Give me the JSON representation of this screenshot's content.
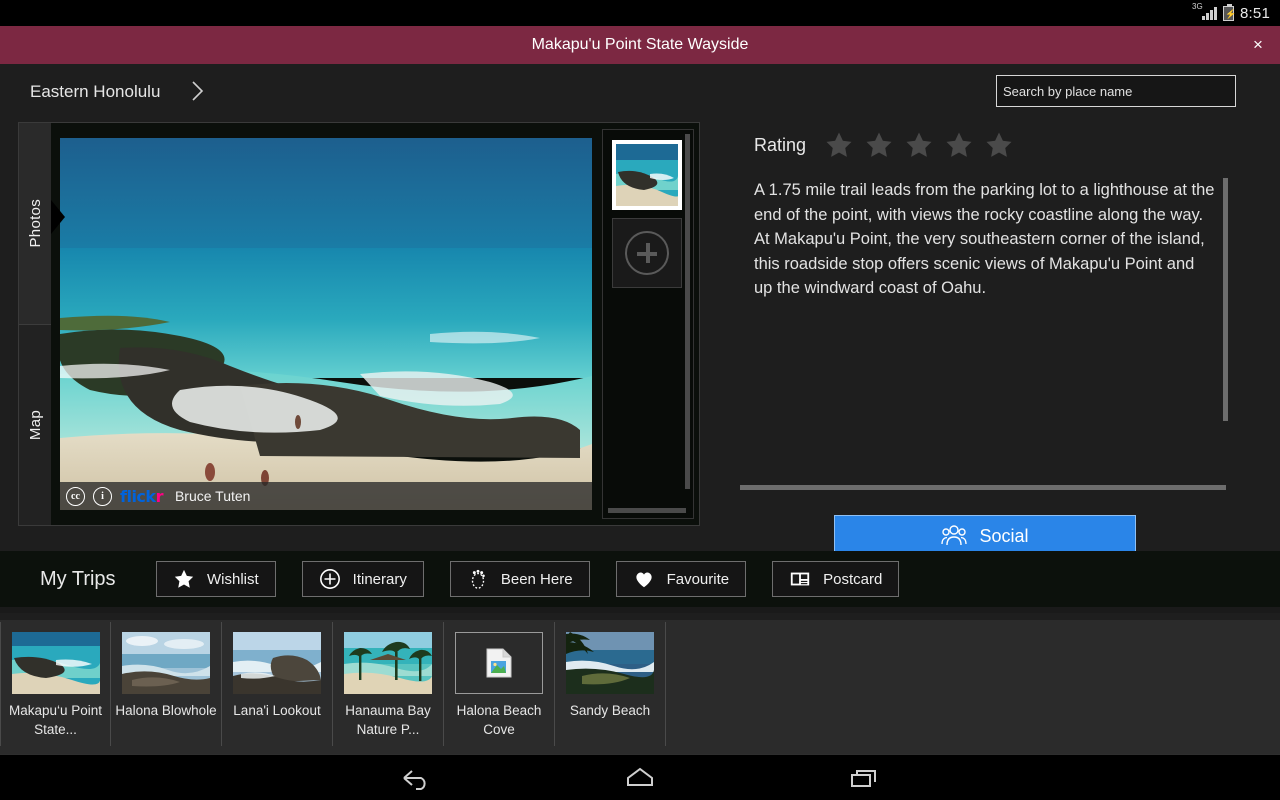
{
  "status_bar": {
    "time": "8:51",
    "network": "3G",
    "signal_icon": "signal-bars-icon",
    "battery_icon": "battery-charging-icon"
  },
  "title_bar": {
    "title": "Makapu'u Point State Wayside",
    "close_label": "×",
    "bg_color": "#7c2842"
  },
  "breadcrumb": {
    "item": "Eastern Honolulu",
    "arrow_icon": "chevron-right-icon"
  },
  "search": {
    "placeholder": "Search by place name",
    "value": ""
  },
  "media": {
    "tabs": [
      {
        "label": "Photos",
        "selected": true
      },
      {
        "label": "Map",
        "selected": false
      }
    ],
    "attribution": {
      "cc_badge": "cc",
      "info_badge": "i",
      "source_part1": "flick",
      "source_part2": "r",
      "author": "Bruce Tuten"
    },
    "thumbnails": [
      {
        "name": "photo-thumbnail-1",
        "selected": true
      },
      {
        "name": "add-photo-button",
        "icon": "plus-icon",
        "selected": false
      }
    ]
  },
  "info": {
    "rating_label": "Rating",
    "stars_total": 5,
    "stars_filled": 0,
    "star_color": "#4a4a4a",
    "description": "A 1.75 mile trail leads from the parking lot to a lighthouse at the end of the point, with views the rocky coastline along the way. At Makapu'u Point, the very southeastern corner of the island, this roadside stop offers scenic views of Makapu'u Point and up the windward coast of Oahu.",
    "social_button": {
      "label": "Social",
      "icon": "people-group-icon",
      "color": "#2a85e8"
    }
  },
  "my_trips": {
    "label": "My Trips",
    "buttons": [
      {
        "label": "Wishlist",
        "icon": "star-icon"
      },
      {
        "label": "Itinerary",
        "icon": "plus-circle-icon"
      },
      {
        "label": "Been Here",
        "icon": "footprint-icon"
      },
      {
        "label": "Favourite",
        "icon": "heart-icon"
      },
      {
        "label": "Postcard",
        "icon": "postcard-icon"
      }
    ]
  },
  "places": [
    {
      "name": "Makapu‘u Point State...",
      "has_image": true,
      "selected": true
    },
    {
      "name": "Halona Blowhole",
      "has_image": true,
      "selected": false
    },
    {
      "name": "Lana'i Lookout",
      "has_image": true,
      "selected": false
    },
    {
      "name": "Hanauma Bay Nature P...",
      "has_image": true,
      "selected": false
    },
    {
      "name": "Halona Beach Cove",
      "has_image": false,
      "icon": "broken-image-icon",
      "selected": false
    },
    {
      "name": "Sandy Beach",
      "has_image": true,
      "selected": false
    }
  ],
  "nav_bar": {
    "buttons": [
      {
        "name": "back-button",
        "icon": "back-arrow-icon"
      },
      {
        "name": "home-button",
        "icon": "home-icon"
      },
      {
        "name": "recents-button",
        "icon": "recents-icon"
      }
    ]
  }
}
